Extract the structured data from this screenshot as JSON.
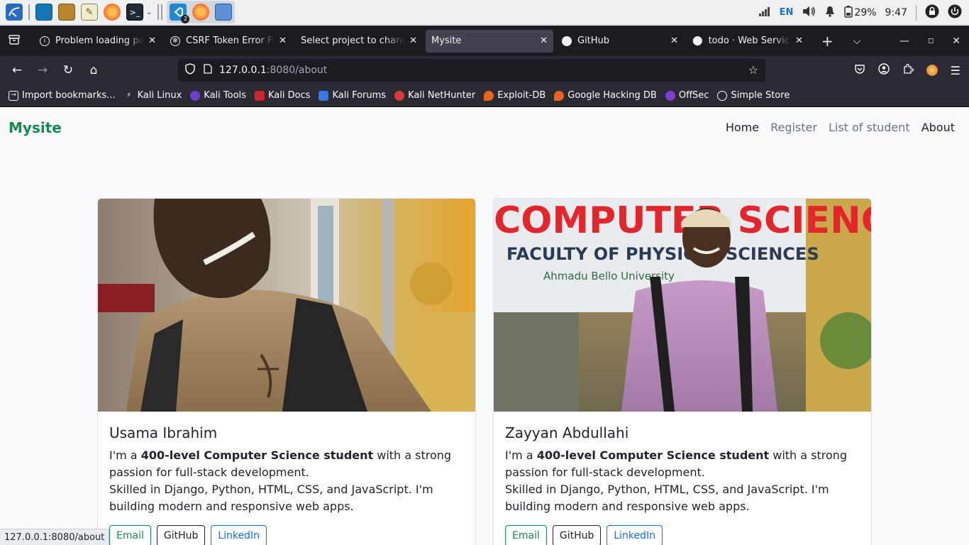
{
  "taskbar": {
    "language": "EN",
    "battery": "29%",
    "time": "9:47",
    "vscode_badge": "2"
  },
  "tabs": [
    {
      "title": "Problem loading page",
      "icon": "info-icon"
    },
    {
      "title": "CSRF Token Error Fix",
      "icon": "chatgpt-icon"
    },
    {
      "title": "Select project to change",
      "icon": "none"
    },
    {
      "title": "Mysite",
      "icon": "none",
      "active": true
    },
    {
      "title": "GitHub",
      "icon": "github-icon"
    },
    {
      "title": "todo · Web Services",
      "icon": "render-icon"
    }
  ],
  "urlbar": {
    "host": "127.0.0.1",
    "path": ":8080/about"
  },
  "bookmarks": [
    "Import bookmarks...",
    "Kali Linux",
    "Kali Tools",
    "Kali Docs",
    "Kali Forums",
    "Kali NetHunter",
    "Exploit-DB",
    "Google Hacking DB",
    "OffSec",
    "Simple Store"
  ],
  "site": {
    "brand": "Mysite",
    "menu": [
      "Home",
      "Register",
      "List of student",
      "About"
    ]
  },
  "cards": [
    {
      "name": "Usama Ibrahim",
      "bio_pre": "I'm a ",
      "bio_bold": "400-level Computer Science student",
      "bio_post": " with a strong passion for full-stack development.",
      "bio_line2": "Skilled in Django, Python, HTML, CSS, and JavaScript. I'm building modern and responsive web apps.",
      "btn_email": "Email",
      "btn_github": "GitHub",
      "btn_linkedin": "LinkedIn"
    },
    {
      "name": "Zayyan Abdullahi",
      "bio_pre": "I'm a ",
      "bio_bold": "400-level Computer Science student",
      "bio_post": " with a strong passion for full-stack development.",
      "bio_line2": "Skilled in Django, Python, HTML, CSS, and JavaScript. I'm building modern and responsive web apps.",
      "btn_email": "Email",
      "btn_github": "GitHub",
      "btn_linkedin": "LinkedIn",
      "photo_sign_line1": "COMPUTER SCIENCE",
      "photo_sign_line2": "FACULTY OF PHYSICAL SCIENCES",
      "photo_sign_line3": "Ahmadu Bello University"
    }
  ],
  "statusbar": "127.0.0.1:8080/about"
}
